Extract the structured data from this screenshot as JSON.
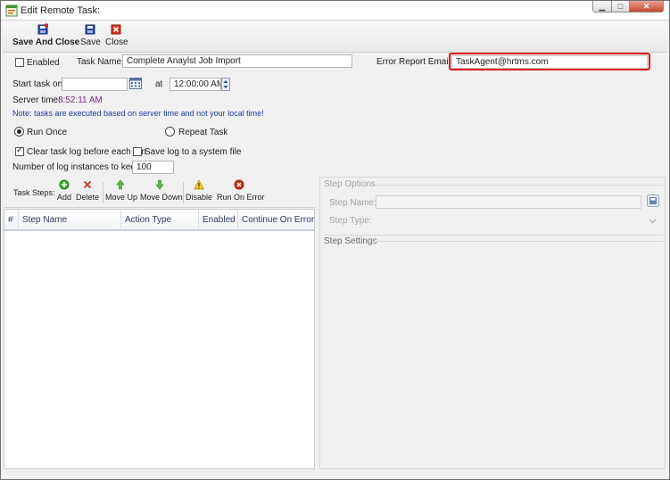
{
  "window": {
    "title": "Edit Remote Task:"
  },
  "window_buttons": {
    "minimize": "▁",
    "maximize": "□",
    "close": "✕"
  },
  "toolbar": {
    "save_and_close": "Save And Close",
    "save": "Save",
    "close": "Close"
  },
  "task": {
    "enabled_label": "Enabled",
    "enabled": false,
    "name_label": "Task Name:",
    "name_value": "Complete Anaylst Job Import",
    "error_email_label": "Error Report Email:",
    "error_email_value": "TaskAgent@hrtms.com",
    "start_label": "Start task on",
    "start_date_value": "",
    "at_label": "at",
    "start_time_value": "12:00:00 AM",
    "server_time_label": "Server time:",
    "server_time_value": "8:52:11 AM",
    "note": "Note: tasks are executed based on server time and not your local time!",
    "run_once_label": "Run Once",
    "repeat_task_label": "Repeat Task",
    "clear_log_label": "Clear task log before each run",
    "clear_log_checked": true,
    "save_log_label": "Save log to a system file",
    "save_log_checked": false,
    "log_instances_label": "Number of log instances to keep:",
    "log_instances_value": "100"
  },
  "steps_toolbar": {
    "label": "Task Steps:",
    "add": "Add",
    "delete": "Delete",
    "move_up": "Move Up",
    "move_down": "Move Down",
    "disable": "Disable",
    "run_on_error": "Run On Error"
  },
  "steps_grid": {
    "columns": [
      "#",
      "Step Name",
      "Action Type",
      "Enabled",
      "Continue On Error"
    ],
    "rows": []
  },
  "step_options": {
    "legend": "Step Options",
    "step_name_label": "Step Name:",
    "step_name_value": "",
    "step_type_label": "Step Type:",
    "step_type_value": "",
    "settings_legend": "Step Settings"
  },
  "colors": {
    "highlight_border": "#e0161b",
    "server_time": "#7a2a8a",
    "note": "#1e3a9c",
    "grid_header_text": "#2f3b63"
  },
  "icons": [
    "app-window-icon",
    "save-close-icon",
    "save-icon",
    "close-icon",
    "calendar-icon",
    "spin-icon",
    "add-icon",
    "delete-icon",
    "move-up-icon",
    "move-down-icon",
    "disable-icon",
    "run-on-error-icon",
    "browse-icon",
    "chevron-down-icon"
  ]
}
